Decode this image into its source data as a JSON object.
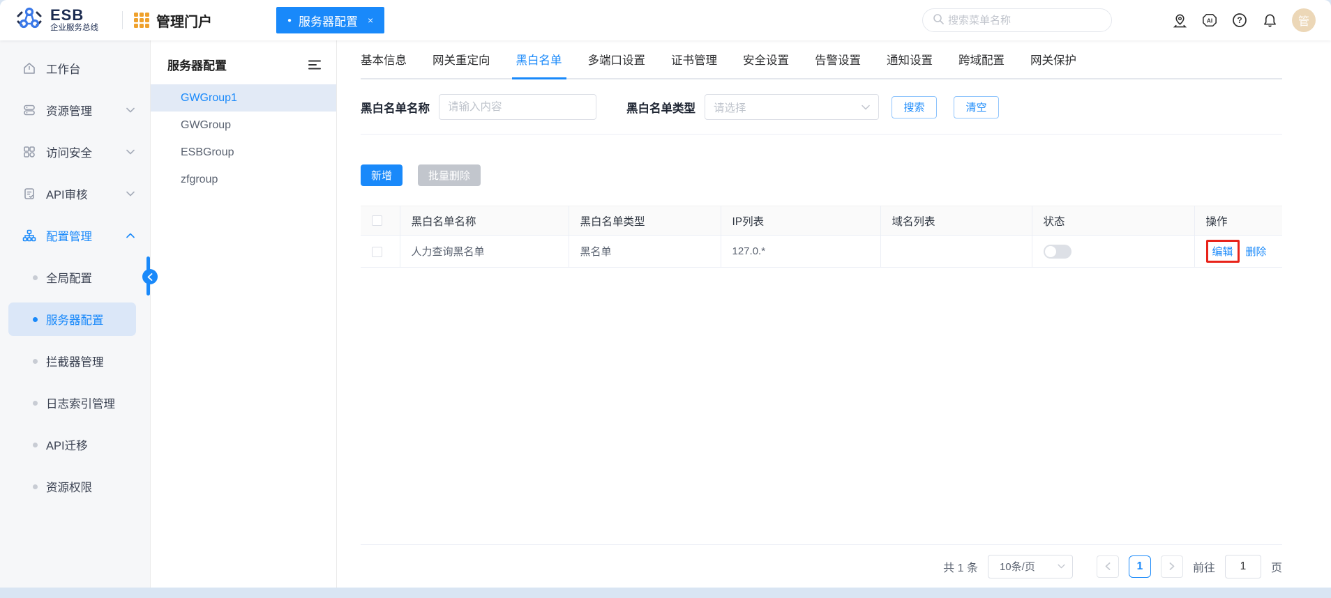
{
  "header": {
    "logo_title": "ESB",
    "logo_subtitle": "企业服务总线",
    "portal_title": "管理门户",
    "active_tab": {
      "dot": "●",
      "label": "服务器配置",
      "close": "×"
    },
    "search_placeholder": "搜索菜单名称",
    "avatar_text": "管"
  },
  "sidebar": {
    "items": [
      {
        "label": "工作台"
      },
      {
        "label": "资源管理"
      },
      {
        "label": "访问安全"
      },
      {
        "label": "API审核"
      },
      {
        "label": "配置管理"
      }
    ],
    "submenu": [
      {
        "label": "全局配置"
      },
      {
        "label": "服务器配置"
      },
      {
        "label": "拦截器管理"
      },
      {
        "label": "日志索引管理"
      },
      {
        "label": "API迁移"
      },
      {
        "label": "资源权限"
      }
    ]
  },
  "group_panel": {
    "title": "服务器配置",
    "items": [
      {
        "label": "GWGroup1"
      },
      {
        "label": "GWGroup"
      },
      {
        "label": "ESBGroup"
      },
      {
        "label": "zfgroup"
      }
    ]
  },
  "main": {
    "tabs": [
      {
        "label": "基本信息"
      },
      {
        "label": "网关重定向"
      },
      {
        "label": "黑白名单"
      },
      {
        "label": "多端口设置"
      },
      {
        "label": "证书管理"
      },
      {
        "label": "安全设置"
      },
      {
        "label": "告警设置"
      },
      {
        "label": "通知设置"
      },
      {
        "label": "跨域配置"
      },
      {
        "label": "网关保护"
      }
    ],
    "filter": {
      "name_label": "黑白名单名称",
      "name_placeholder": "请输入内容",
      "type_label": "黑白名单类型",
      "type_placeholder": "请选择",
      "search_button": "搜索",
      "clear_button": "清空"
    },
    "actions": {
      "add_button": "新增",
      "batch_delete_button": "批量删除"
    },
    "table": {
      "columns": [
        "黑白名单名称",
        "黑白名单类型",
        "IP列表",
        "域名列表",
        "状态",
        "操作"
      ],
      "rows": [
        {
          "name": "人力查询黑名单",
          "type": "黑名单",
          "ip_list": "127.0.*",
          "domain_list": "",
          "status_on": false,
          "edit_label": "编辑",
          "delete_label": "删除"
        }
      ]
    },
    "pagination": {
      "total_text": "共 1 条",
      "page_size": "10条/页",
      "current_page": "1",
      "goto_label": "前往",
      "goto_value": "1",
      "page_unit": "页"
    }
  },
  "colors": {
    "primary": "#1989fa",
    "annotation_red": "#e8231a",
    "portal_icon_orange": "#efa12c",
    "avatar_bg": "#ecd7b7"
  }
}
